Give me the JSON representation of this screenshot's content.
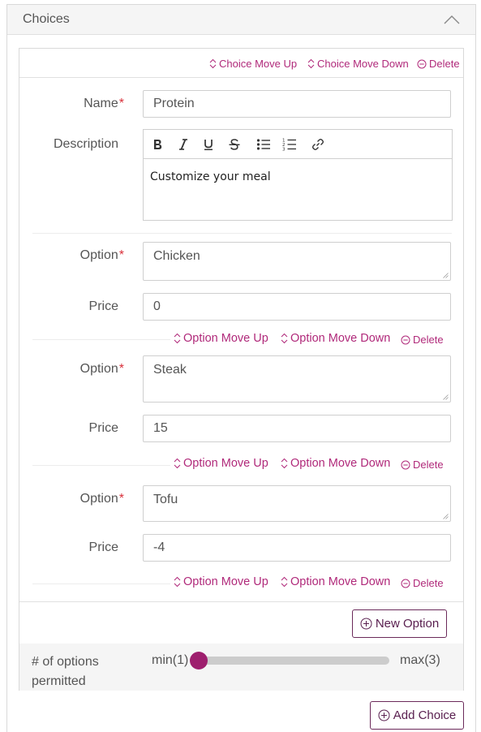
{
  "panel": {
    "title": "Choices"
  },
  "choice": {
    "actions": {
      "move_up": "Choice Move Up",
      "move_down": "Choice Move Down",
      "delete": "Delete"
    },
    "name_label": "Name",
    "name_value": "Protein",
    "description_label": "Description",
    "description_value": "Customize your meal",
    "toolbar": [
      "bold",
      "italic",
      "underline",
      "strikethrough",
      "bulleted-list",
      "numbered-list",
      "link"
    ]
  },
  "option_label": "Option",
  "price_label": "Price",
  "required_mark": "*",
  "option_actions": {
    "move_up": "Option Move Up",
    "move_down": "Option Move Down",
    "delete": "Delete"
  },
  "options": [
    {
      "name": "Chicken",
      "price": "0"
    },
    {
      "name": "Steak",
      "price": "15"
    },
    {
      "name": "Tofu",
      "price": "-4"
    }
  ],
  "new_option_label": "New Option",
  "permitted": {
    "label_line1": "# of options",
    "label_line2": "permitted",
    "min_label": "min(1)",
    "max_label": "max(3)",
    "min": 1,
    "max": 3,
    "value": 1
  },
  "add_choice_label": "Add Choice",
  "colors": {
    "accent": "#b0297a",
    "thumb": "#9e1f6e",
    "button_border": "#6b2a5a",
    "required": "#d9303a"
  }
}
